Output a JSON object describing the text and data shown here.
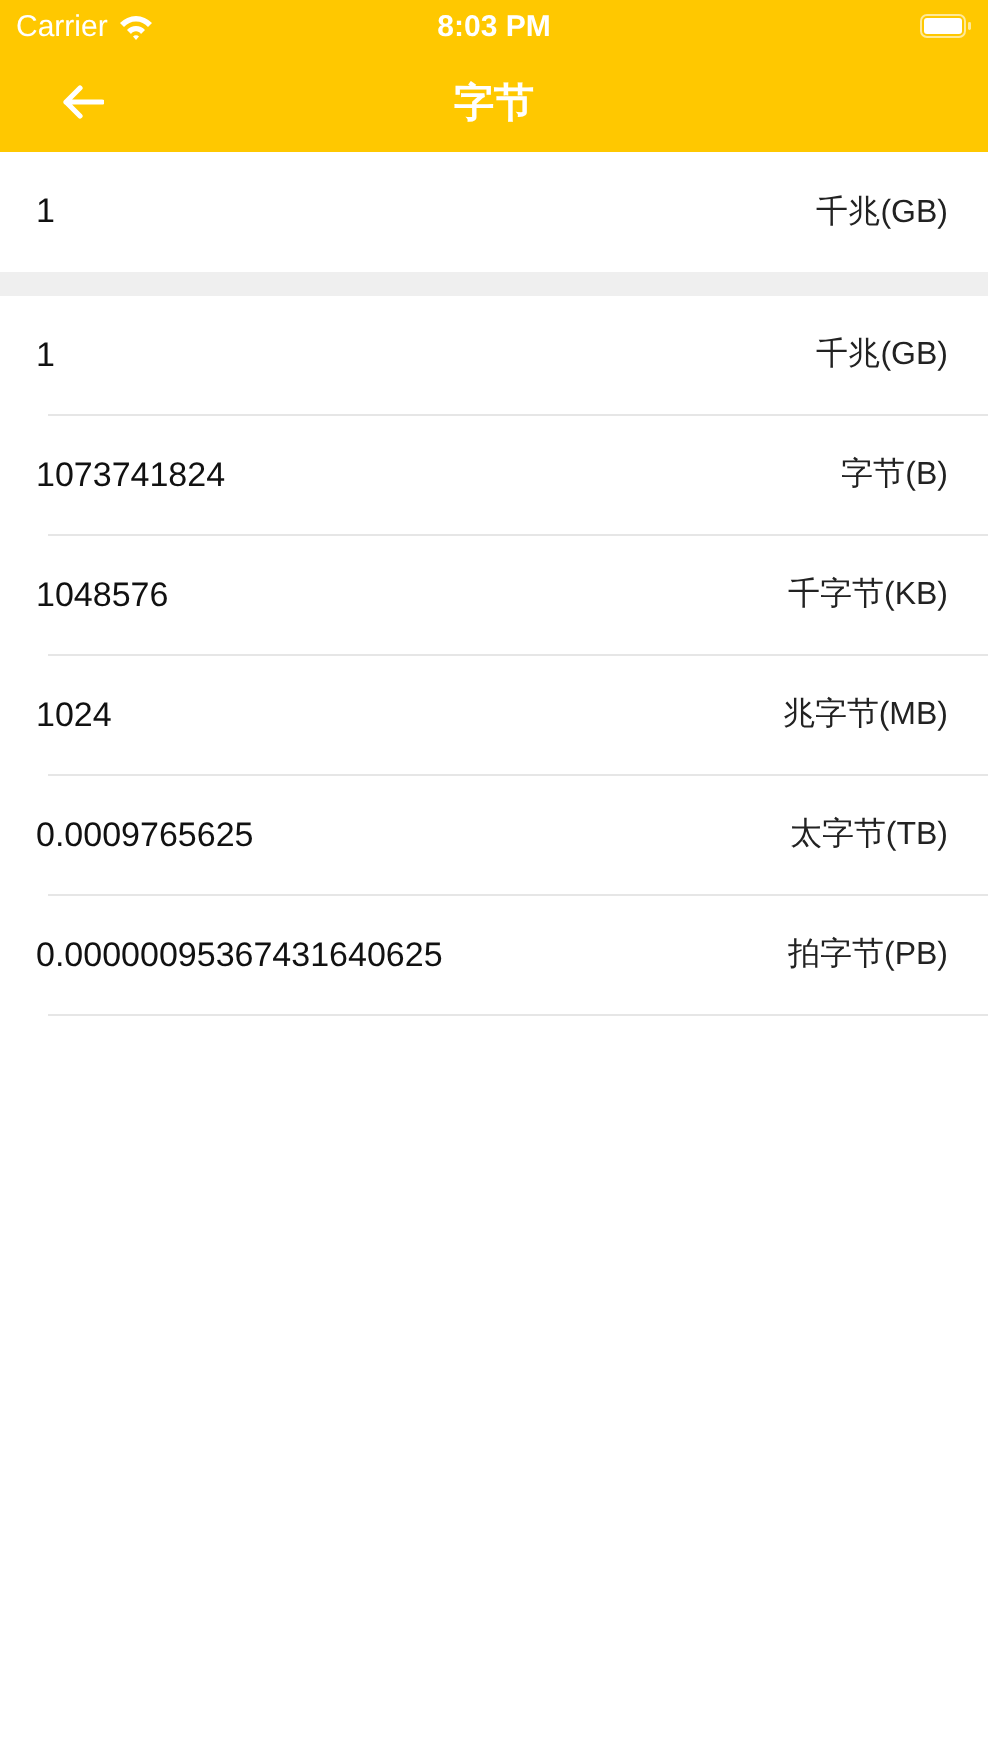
{
  "status_bar": {
    "carrier": "Carrier",
    "time": "8:03 PM"
  },
  "nav_bar": {
    "title": "字节"
  },
  "input": {
    "value": "1",
    "unit": "千兆(GB)"
  },
  "results": [
    {
      "value": "1",
      "unit": "千兆(GB)"
    },
    {
      "value": "1073741824",
      "unit": "字节(B)"
    },
    {
      "value": "1048576",
      "unit": "千字节(KB)"
    },
    {
      "value": "1024",
      "unit": "兆字节(MB)"
    },
    {
      "value": "0.0009765625",
      "unit": "太字节(TB)"
    },
    {
      "value": "0.00000095367431640625",
      "unit": "拍字节(PB)"
    }
  ]
}
